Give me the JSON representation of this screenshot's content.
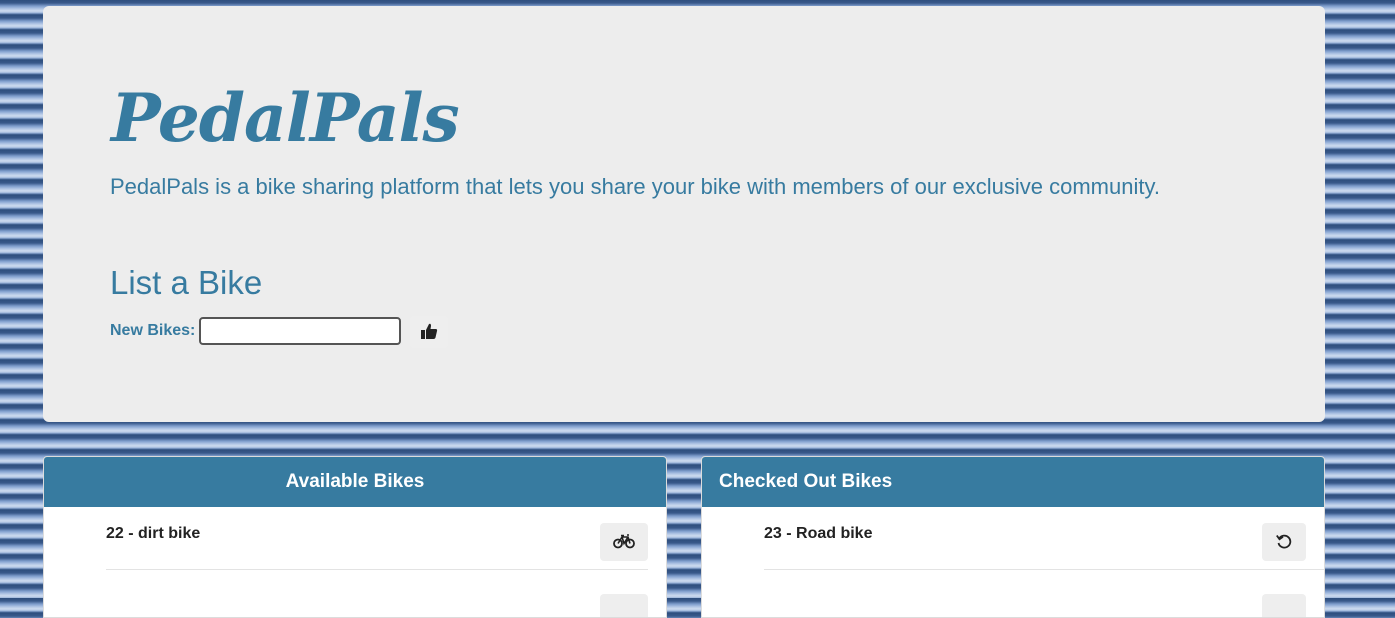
{
  "header": {
    "brand": "PedalPals",
    "tagline": "PedalPals is a bike sharing platform that lets you share your bike with members of our exclusive community.",
    "list_title": "List a Bike",
    "new_bikes_label": "New Bikes:",
    "new_bikes_value": "",
    "submit_icon": "thumbs-up-icon"
  },
  "available": {
    "title": "Available Bikes",
    "items": [
      {
        "label": "22 - dirt bike",
        "action_icon": "bicycle-icon"
      }
    ]
  },
  "checked_out": {
    "title": "Checked Out Bikes",
    "items": [
      {
        "label": "23 - Road bike",
        "action_icon": "undo-icon"
      }
    ]
  },
  "colors": {
    "accent": "#377ba0",
    "panel_bg": "#ededed"
  }
}
